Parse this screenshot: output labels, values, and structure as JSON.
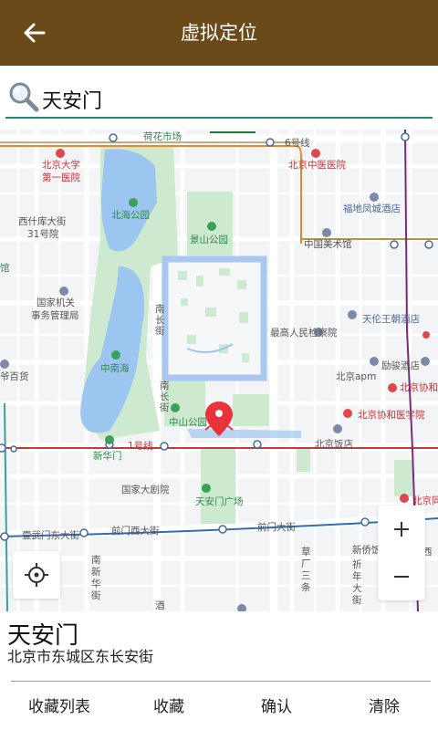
{
  "header": {
    "title": "虚拟定位",
    "back_icon": "arrow-left-icon",
    "background": "#6b4a1a"
  },
  "search": {
    "icon": "search-icon",
    "value": "天安门",
    "accent": "#1a8a78"
  },
  "map": {
    "labels": {
      "hehua": "荷花市场",
      "pku1": "北京大学",
      "pku2": "第一医院",
      "xishiku1": "西什库大街",
      "xishiku2": "31号院",
      "beihai": "北海公园",
      "jingshan": "景山公园",
      "zyy": "北京中医医院",
      "fudi": "福地凤城酒店",
      "meishu": "中国美术馆",
      "guanguan": "馆",
      "guojia1": "国家机关",
      "guojia2": "事务管理局",
      "nanchang1": "南",
      "nanchang2": "长",
      "nanchang3": "街",
      "tianlun": "天伦王朝酒店",
      "jiancha": "最高人民检察院",
      "zhongnanhai": "中南海",
      "baihuo": "爷百货",
      "apm": "北京apm",
      "xiehe": "北京协和",
      "xieheyy": "北京协和医学院",
      "lixiang": "励骏酒店",
      "nanchangb1": "南",
      "nanchangb2": "长",
      "nanchangb3": "街",
      "zhongshan": "中山公园",
      "fandian": "北京饭店",
      "xinhuamen": "新华门",
      "line1": "1号线",
      "juyuan": "国家大剧院",
      "guangchang": "天安门广场",
      "beijingr": "北京同",
      "qianmenxi": "前门西大街",
      "qianmendong": "前门大街",
      "xuanwu": "壹武门东大街",
      "nanxin1": "南",
      "nanxin2": "新",
      "nanxin3": "华",
      "nanxin4": "街",
      "zhengyi1": "草",
      "zhengyi2": "厂",
      "zhengyi3": "三",
      "zhengyi4": "条",
      "xinqiao": "新侨饭",
      "xinqiaob1": "祈",
      "xinqiaob2": "年",
      "xinqiaob3": "大",
      "xinqiaob4": "街",
      "line6": "6号线",
      "jiuxian": "酒",
      "xi": "西"
    },
    "marker_icon": "map-pin-icon",
    "marker_color": "#e8333a"
  },
  "controls": {
    "zoom_in_icon": "plus-icon",
    "zoom_out_icon": "minus-icon",
    "locate_icon": "crosshair-icon"
  },
  "place": {
    "name": "天安门",
    "address": "北京市东城区东长安街"
  },
  "bottom_bar": {
    "favorites_list": "收藏列表",
    "favorite": "收藏",
    "confirm": "确认",
    "clear": "清除"
  }
}
